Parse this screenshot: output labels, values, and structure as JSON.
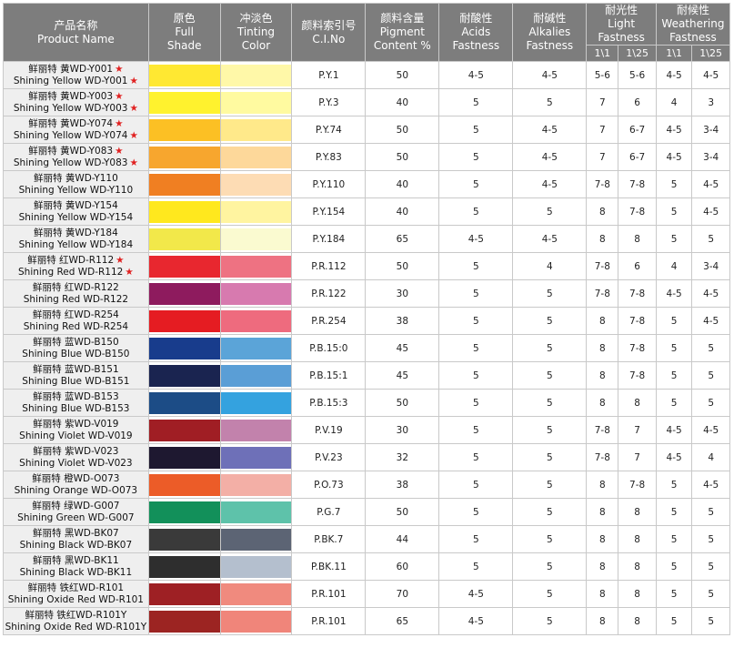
{
  "header": {
    "product_name_zh": "产品名称",
    "product_name_en": "Product Name",
    "full_shade_zh": "原色",
    "full_shade_en_1": "Full",
    "full_shade_en_2": "Shade",
    "tinting_zh": "冲淡色",
    "tinting_en_1": "Tinting",
    "tinting_en_2": "Color",
    "cino_zh": "颜料索引号",
    "cino_en": "C.I.No",
    "pigment_zh": "颜料含量",
    "pigment_en_1": "Pigment",
    "pigment_en_2": "Content %",
    "acids_zh": "耐酸性",
    "acids_en_1": "Acids",
    "acids_en_2": "Fastness",
    "alk_zh": "耐碱性",
    "alk_en_1": "Alkalies",
    "alk_en_2": "Fastness",
    "light_zh": "耐光性",
    "light_en_1": "Light",
    "light_en_2": "Fastness",
    "weather_zh": "耐候性",
    "weather_en_1": "Weathering",
    "weather_en_2": "Fastness",
    "sub_1": "1\\1",
    "sub_2": "1\\25",
    "sub_3": "1\\1",
    "sub_4": "1\\25"
  },
  "rows": [
    {
      "zh": "鲜丽特 黄WD-Y001",
      "en": "Shining Yellow WD-Y001",
      "star_zh": true,
      "star_en": true,
      "full": "#FFE832",
      "tint": "#FFF8A8",
      "ci": "P.Y.1",
      "content": "50",
      "acid": "4-5",
      "alk": "4-5",
      "l1": "5-6",
      "l25": "5-6",
      "w1": "4-5",
      "w25": "4-5"
    },
    {
      "zh": "鲜丽特 黄WD-Y003",
      "en": "Shining Yellow WD-Y003",
      "star_zh": true,
      "star_en": true,
      "full": "#FFF22E",
      "tint": "#FFFAA0",
      "ci": "P.Y.3",
      "content": "40",
      "acid": "5",
      "alk": "5",
      "l1": "7",
      "l25": "6",
      "w1": "4",
      "w25": "3"
    },
    {
      "zh": "鲜丽特 黄WD-Y074",
      "en": "Shining Yellow WD-Y074",
      "star_zh": true,
      "star_en": true,
      "full": "#FCC024",
      "tint": "#FFE98A",
      "ci": "P.Y.74",
      "content": "50",
      "acid": "5",
      "alk": "4-5",
      "l1": "7",
      "l25": "6-7",
      "w1": "4-5",
      "w25": "3-4"
    },
    {
      "zh": "鲜丽特 黄WD-Y083",
      "en": "Shining Yellow WD-Y083",
      "star_zh": true,
      "star_en": true,
      "full": "#F7A62E",
      "tint": "#FDD89A",
      "ci": "P.Y.83",
      "content": "50",
      "acid": "5",
      "alk": "4-5",
      "l1": "7",
      "l25": "6-7",
      "w1": "4-5",
      "w25": "3-4"
    },
    {
      "zh": "鲜丽特 黄WD-Y110",
      "en": "Shining Yellow WD-Y110",
      "star_zh": false,
      "star_en": false,
      "full": "#F07F22",
      "tint": "#FDDCB4",
      "ci": "P.Y.110",
      "content": "40",
      "acid": "5",
      "alk": "4-5",
      "l1": "7-8",
      "l25": "7-8",
      "w1": "5",
      "w25": "4-5"
    },
    {
      "zh": "鲜丽特 黄WD-Y154",
      "en": "Shining Yellow WD-Y154",
      "star_zh": false,
      "star_en": false,
      "full": "#FFE81E",
      "tint": "#FFF4A0",
      "ci": "P.Y.154",
      "content": "40",
      "acid": "5",
      "alk": "5",
      "l1": "8",
      "l25": "7-8",
      "w1": "5",
      "w25": "4-5"
    },
    {
      "zh": "鲜丽特 黄WD-Y184",
      "en": "Shining Yellow WD-Y184",
      "star_zh": false,
      "star_en": false,
      "full": "#F2E84A",
      "tint": "#FAFAD0",
      "ci": "P.Y.184",
      "content": "65",
      "acid": "4-5",
      "alk": "4-5",
      "l1": "8",
      "l25": "8",
      "w1": "5",
      "w25": "5"
    },
    {
      "zh": "鲜丽特 红WD-R112",
      "en": "Shining Red WD-R112",
      "star_zh": true,
      "star_en": true,
      "full": "#E8272F",
      "tint": "#EE7282",
      "ci": "P.R.112",
      "content": "50",
      "acid": "5",
      "alk": "4",
      "l1": "7-8",
      "l25": "6",
      "w1": "4",
      "w25": "3-4"
    },
    {
      "zh": "鲜丽特 红WD-R122",
      "en": "Shining Red WD-R122",
      "star_zh": false,
      "star_en": false,
      "full": "#8E1B5E",
      "tint": "#D77AAF",
      "ci": "P.R.122",
      "content": "30",
      "acid": "5",
      "alk": "5",
      "l1": "7-8",
      "l25": "7-8",
      "w1": "4-5",
      "w25": "4-5"
    },
    {
      "zh": "鲜丽特 红WD-R254",
      "en": "Shining Red WD-R254",
      "star_zh": false,
      "star_en": false,
      "full": "#E51C22",
      "tint": "#EE6B7E",
      "ci": "P.R.254",
      "content": "38",
      "acid": "5",
      "alk": "5",
      "l1": "8",
      "l25": "7-8",
      "w1": "5",
      "w25": "4-5"
    },
    {
      "zh": "鲜丽特 蓝WD-B150",
      "en": "Shining Blue WD-B150",
      "star_zh": false,
      "star_en": false,
      "full": "#183C8C",
      "tint": "#5BA4D8",
      "ci": "P.B.15:0",
      "content": "45",
      "acid": "5",
      "alk": "5",
      "l1": "8",
      "l25": "7-8",
      "w1": "5",
      "w25": "5"
    },
    {
      "zh": "鲜丽特 蓝WD-B151",
      "en": "Shining Blue WD-B151",
      "star_zh": false,
      "star_en": false,
      "full": "#1A2450",
      "tint": "#5A9ED6",
      "ci": "P.B.15:1",
      "content": "45",
      "acid": "5",
      "alk": "5",
      "l1": "8",
      "l25": "7-8",
      "w1": "5",
      "w25": "5"
    },
    {
      "zh": "鲜丽特 蓝WD-B153",
      "en": "Shining Blue WD-B153",
      "star_zh": false,
      "star_en": false,
      "full": "#1C4C86",
      "tint": "#34A2DF",
      "ci": "P.B.15:3",
      "content": "50",
      "acid": "5",
      "alk": "5",
      "l1": "8",
      "l25": "8",
      "w1": "5",
      "w25": "5"
    },
    {
      "zh": "鲜丽特 紫WD-V019",
      "en": "Shining Violet WD-V019",
      "star_zh": false,
      "star_en": false,
      "full": "#A01E24",
      "tint": "#C282AC",
      "ci": "P.V.19",
      "content": "30",
      "acid": "5",
      "alk": "5",
      "l1": "7-8",
      "l25": "7",
      "w1": "4-5",
      "w25": "4-5"
    },
    {
      "zh": "鲜丽特 紫WD-V023",
      "en": "Shining Violet WD-V023",
      "star_zh": false,
      "star_en": false,
      "full": "#1E1830",
      "tint": "#6E70B8",
      "ci": "P.V.23",
      "content": "32",
      "acid": "5",
      "alk": "5",
      "l1": "7-8",
      "l25": "7",
      "w1": "4-5",
      "w25": "4"
    },
    {
      "zh": "鲜丽特 橙WD-O073",
      "en": "Shining Orange WD-O073",
      "star_zh": false,
      "star_en": false,
      "full": "#EC5C28",
      "tint": "#F3AFA6",
      "ci": "P.O.73",
      "content": "38",
      "acid": "5",
      "alk": "5",
      "l1": "8",
      "l25": "7-8",
      "w1": "5",
      "w25": "4-5"
    },
    {
      "zh": "鲜丽特 绿WD-G007",
      "en": "Shining Green WD-G007",
      "star_zh": false,
      "star_en": false,
      "full": "#12905A",
      "tint": "#5EC2AA",
      "ci": "P.G.7",
      "content": "50",
      "acid": "5",
      "alk": "5",
      "l1": "8",
      "l25": "8",
      "w1": "5",
      "w25": "5"
    },
    {
      "zh": "鲜丽特 黑WD-BK07",
      "en": "Shining Black WD-BK07",
      "star_zh": false,
      "star_en": false,
      "full": "#3A3A3A",
      "tint": "#5C6474",
      "ci": "P.BK.7",
      "content": "44",
      "acid": "5",
      "alk": "5",
      "l1": "8",
      "l25": "8",
      "w1": "5",
      "w25": "5"
    },
    {
      "zh": "鲜丽特 黑WD-BK11",
      "en": "Shining Black WD-BK11",
      "star_zh": false,
      "star_en": false,
      "full": "#2E2E2E",
      "tint": "#B4BFCE",
      "ci": "P.BK.11",
      "content": "60",
      "acid": "5",
      "alk": "5",
      "l1": "8",
      "l25": "8",
      "w1": "5",
      "w25": "5"
    },
    {
      "zh": "鲜丽特 铁红WD-R101",
      "en": "Shining Oxide Red WD-R101",
      "star_zh": false,
      "star_en": false,
      "full": "#9E2024",
      "tint": "#F08A7E",
      "ci": "P.R.101",
      "content": "70",
      "acid": "4-5",
      "alk": "5",
      "l1": "8",
      "l25": "8",
      "w1": "5",
      "w25": "5"
    },
    {
      "zh": "鲜丽特 铁红WD-R101Y",
      "en": "Shining Oxide Red WD-R101Y",
      "star_zh": false,
      "star_en": false,
      "full": "#9C2422",
      "tint": "#F0857A",
      "ci": "P.R.101",
      "content": "65",
      "acid": "4-5",
      "alk": "5",
      "l1": "8",
      "l25": "8",
      "w1": "5",
      "w25": "5"
    }
  ]
}
